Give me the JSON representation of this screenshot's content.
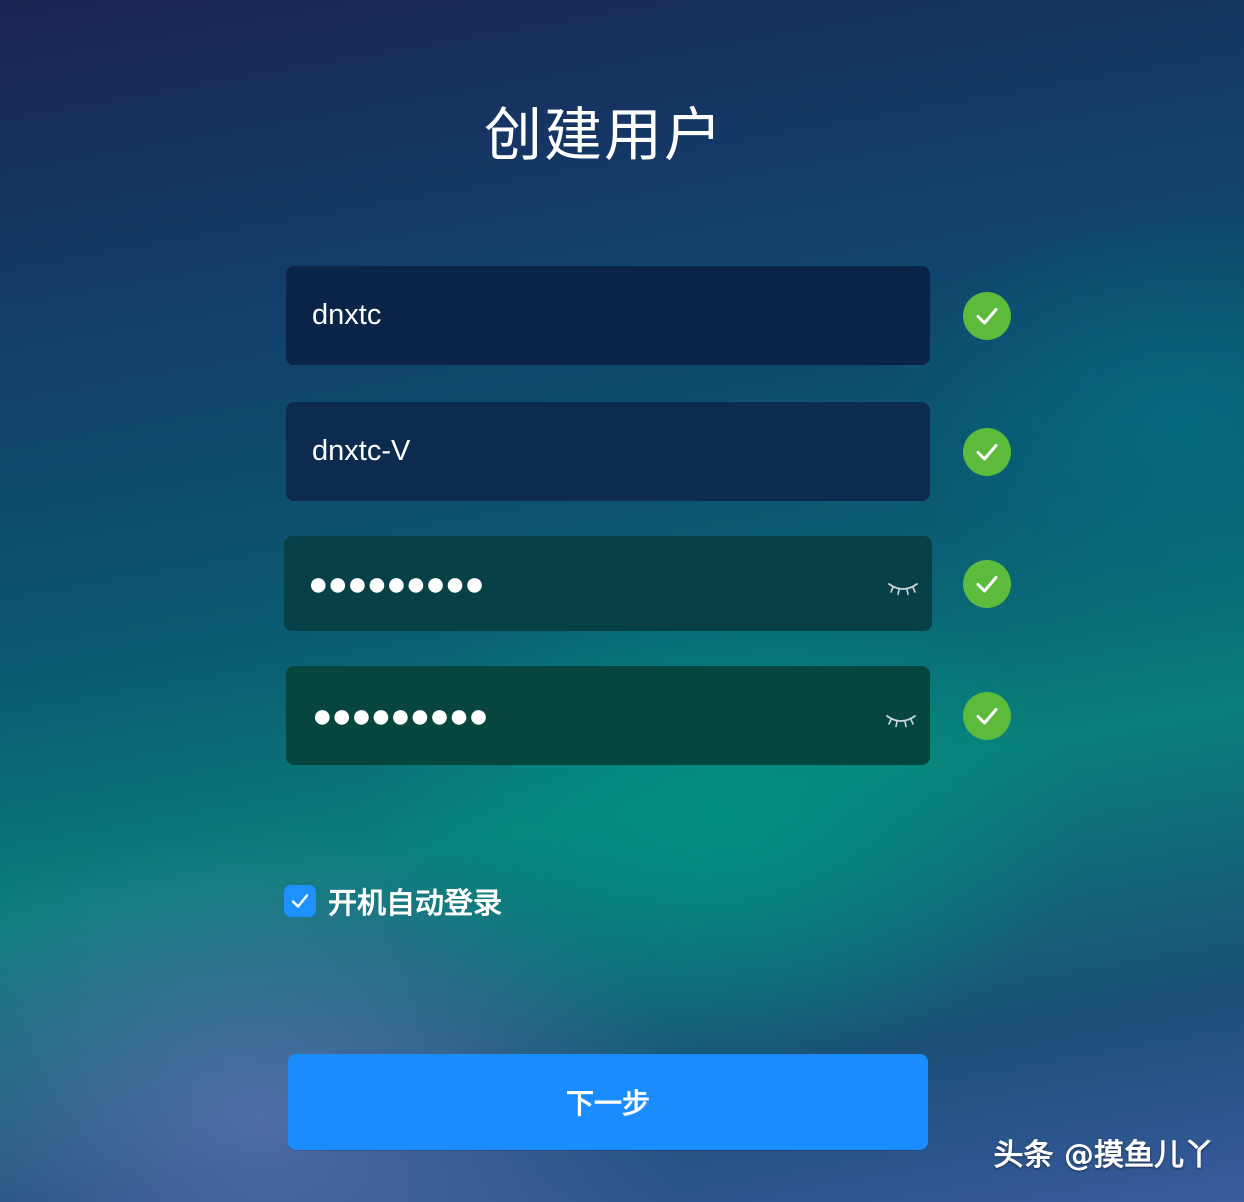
{
  "page": {
    "title": "创建用户"
  },
  "form": {
    "username": {
      "value": "dnxtc",
      "valid": true
    },
    "computer_name": {
      "value": "dnxtc-V",
      "valid": true
    },
    "password": {
      "masked": "●●●●●●●●●",
      "valid": true,
      "visibility_icon": "eye-closed-icon"
    },
    "confirm_password": {
      "masked": "●●●●●●●●●",
      "valid": true,
      "visibility_icon": "eye-closed-icon"
    },
    "auto_login": {
      "label": "开机自动登录",
      "checked": true
    }
  },
  "actions": {
    "next_label": "下一步"
  },
  "watermark": {
    "text": "头条 @摸鱼儿丫"
  },
  "colors": {
    "primary_button": "#1a8cff",
    "valid_check": "#5cbb3a",
    "checkbox": "#1e90ff"
  }
}
